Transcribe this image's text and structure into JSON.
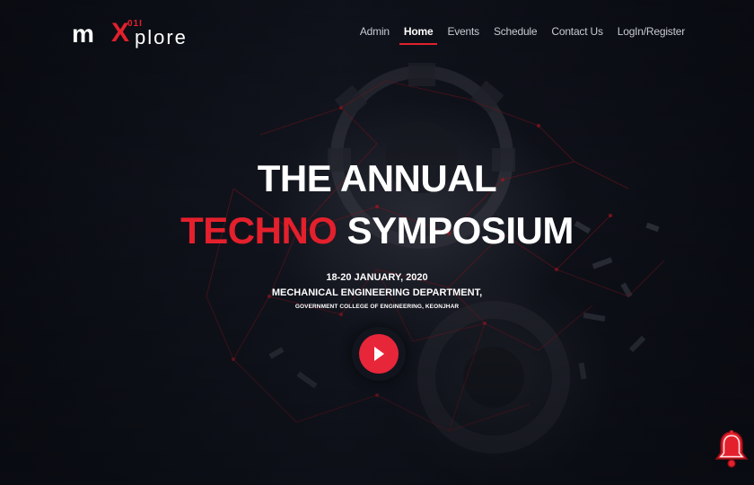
{
  "brand": {
    "main": "m",
    "x": "X",
    "tail": "plore",
    "year": "01I"
  },
  "nav": {
    "items": [
      {
        "label": "Admin",
        "active": false
      },
      {
        "label": "Home",
        "active": true
      },
      {
        "label": "Events",
        "active": false
      },
      {
        "label": "Schedule",
        "active": false
      },
      {
        "label": "Contact Us",
        "active": false
      },
      {
        "label": "LogIn/Register",
        "active": false
      }
    ]
  },
  "hero": {
    "line1": "THE ANNUAL",
    "line2_accent": "TECHNO",
    "line2_rest": "SYMPOSIUM",
    "date": "18-20 JANUARY, 2020",
    "department": "MECHANICAL ENGINEERING DEPARTMENT,",
    "college": "GOVERNMENT COLLEGE OF ENGINEERING, KEONJHAR"
  },
  "icons": {
    "play": "play-icon",
    "bell": "bell-icon"
  },
  "colors": {
    "accent": "#e3202c",
    "play_button": "#e8263a",
    "background": "#0d0f17"
  }
}
